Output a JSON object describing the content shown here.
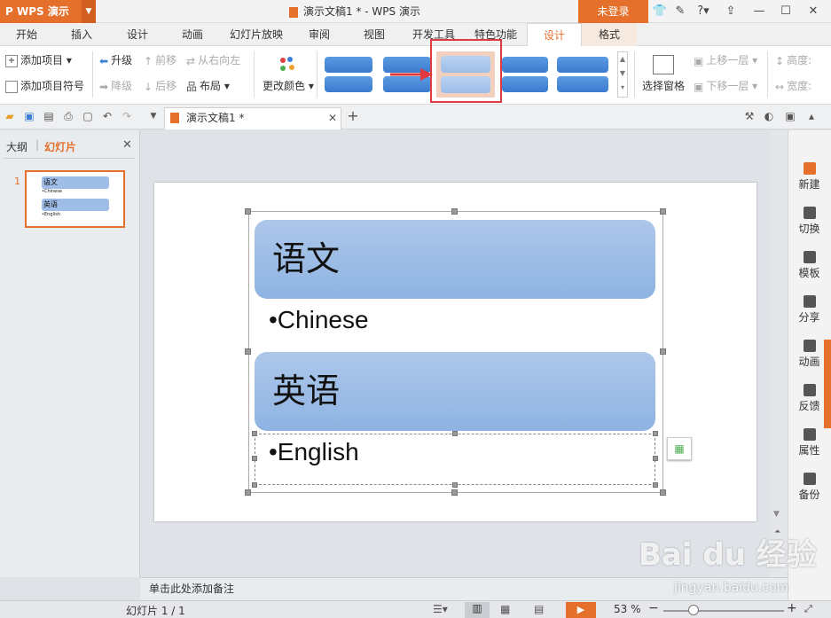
{
  "app": {
    "name": "WPS 演示",
    "doc_title": "演示文稿1 * - WPS 演示",
    "login": "未登录"
  },
  "tabs": [
    "开始",
    "插入",
    "设计",
    "动画",
    "幻灯片放映",
    "审阅",
    "视图",
    "开发工具",
    "特色功能",
    "设计",
    "格式"
  ],
  "ribbon": {
    "add_item": "添加项目",
    "add_bullet": "添加项目符号",
    "promote": "升级",
    "demote": "降级",
    "move_forward": "前移",
    "move_back": "后移",
    "rtl": "从右向左",
    "layout": "布局",
    "change_color": "更改颜色",
    "selection_pane": "选择窗格",
    "move_up": "上移一层",
    "move_down": "下移一层",
    "height": "高度:",
    "width": "宽度:"
  },
  "doc_tab": "演示文稿1 *",
  "left_panel": {
    "tab_outline": "大纲",
    "tab_slides": "幻灯片",
    "slide_number": "1",
    "thumb": {
      "item1": "语文",
      "sub1": "•Chinese",
      "item2": "英语",
      "sub2": "•English"
    }
  },
  "slide": {
    "item1": "语文",
    "sub1": "•Chinese",
    "item2": "英语",
    "sub2": "•English"
  },
  "right_bar": [
    "新建",
    "切换",
    "模板",
    "分享",
    "动画",
    "反馈",
    "属性",
    "备份"
  ],
  "notes_placeholder": "单击此处添加备注",
  "status": {
    "slide_info": "幻灯片 1 / 1",
    "zoom": "53 %"
  },
  "watermark": {
    "brand": "Bai du 经验",
    "url": "jingyan.baidu.com"
  },
  "colors": {
    "accent": "#e5702c",
    "smartart_fill": "#9ebde7",
    "highlight": "#e0393e"
  }
}
